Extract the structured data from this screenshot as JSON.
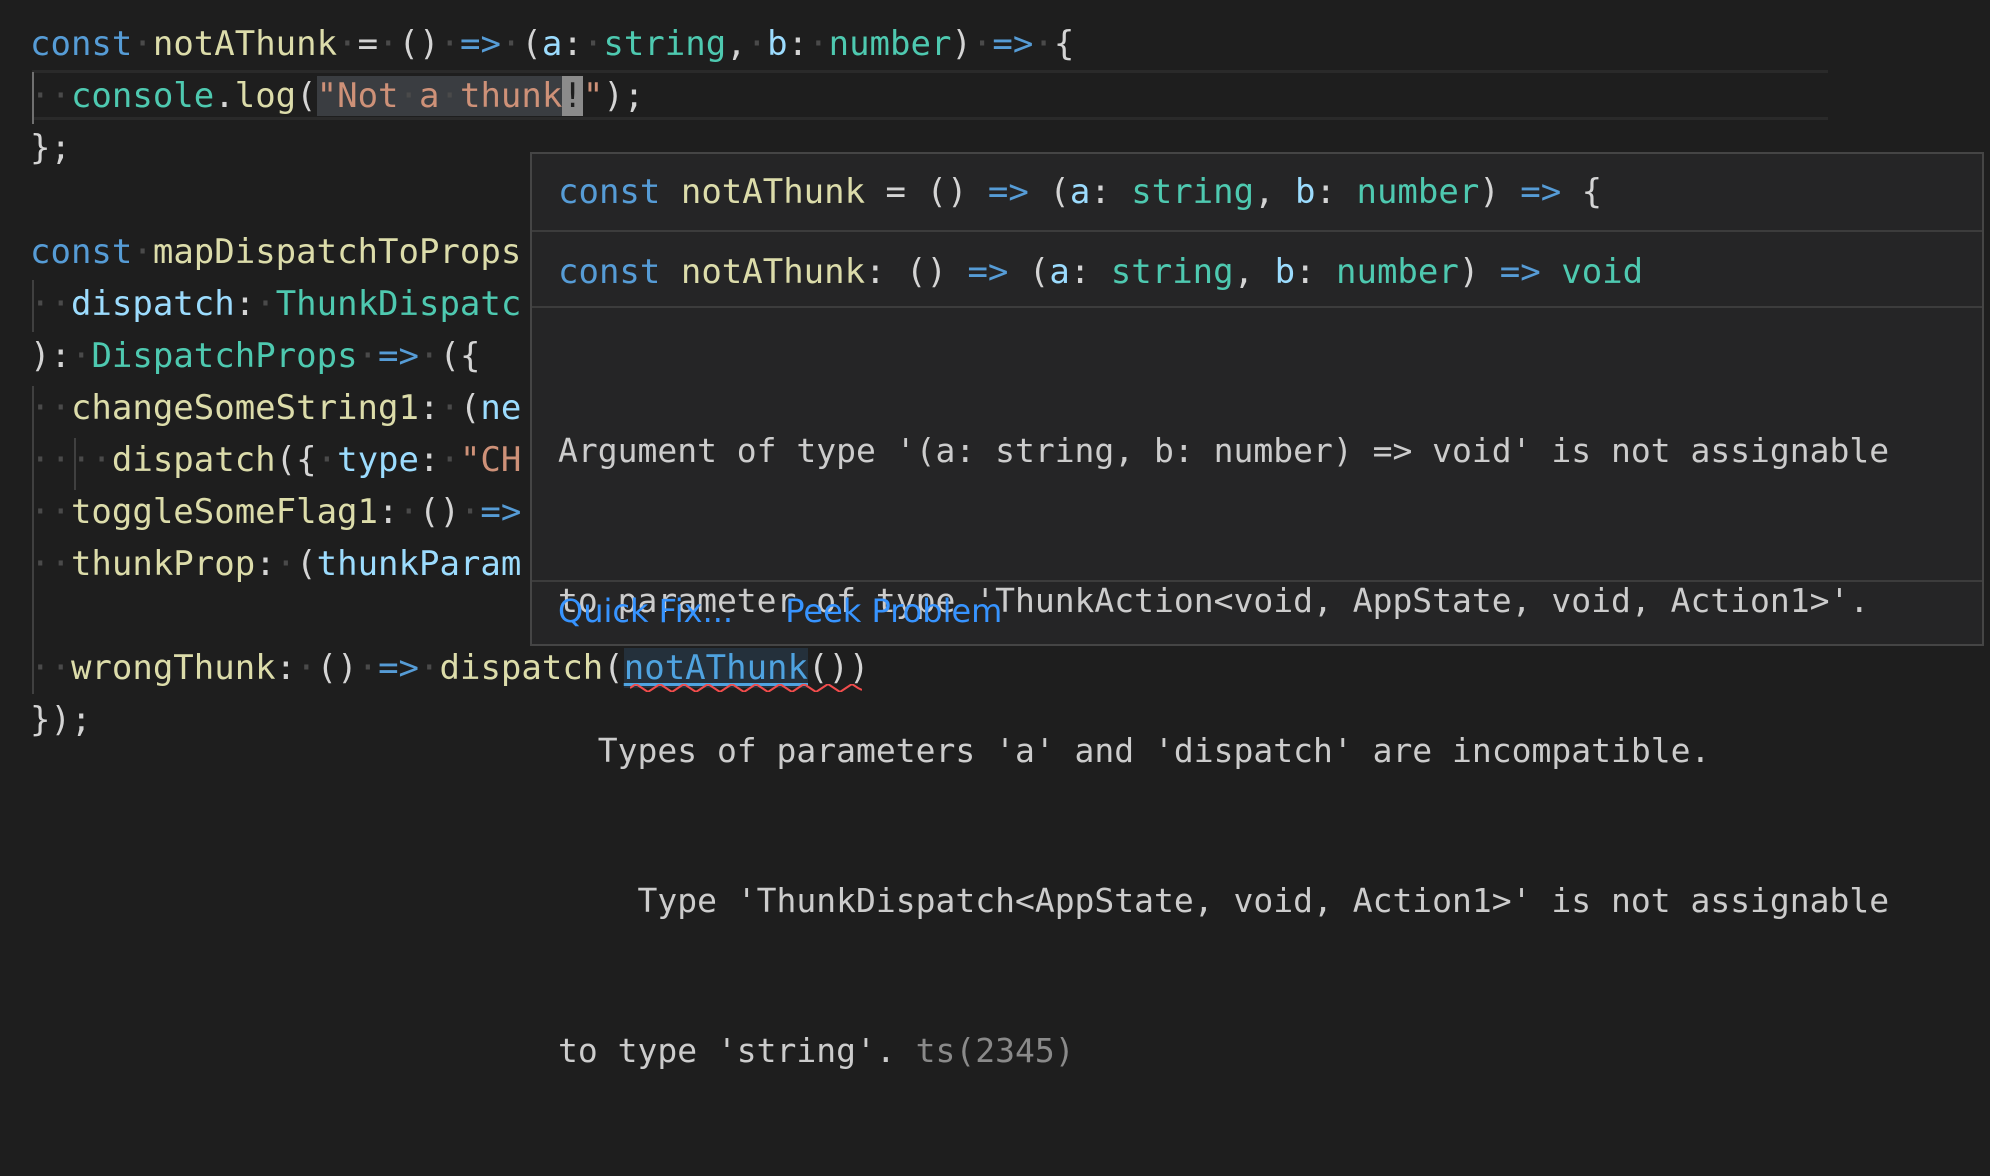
{
  "editor": {
    "lines": [
      {
        "tokens": [
          {
            "c": "kw",
            "t": "const"
          },
          {
            "c": "ws",
            "t": "·"
          },
          {
            "c": "fn",
            "t": "notAThunk"
          },
          {
            "c": "ws",
            "t": "·"
          },
          {
            "c": "pu",
            "t": "="
          },
          {
            "c": "ws",
            "t": "·"
          },
          {
            "c": "pu",
            "t": "()"
          },
          {
            "c": "ws",
            "t": "·"
          },
          {
            "c": "kw",
            "t": "=>"
          },
          {
            "c": "ws",
            "t": "·"
          },
          {
            "c": "pu",
            "t": "("
          },
          {
            "c": "pa",
            "t": "a"
          },
          {
            "c": "pu",
            "t": ":"
          },
          {
            "c": "ws",
            "t": "·"
          },
          {
            "c": "ty",
            "t": "string"
          },
          {
            "c": "pu",
            "t": ","
          },
          {
            "c": "ws",
            "t": "·"
          },
          {
            "c": "pa",
            "t": "b"
          },
          {
            "c": "pu",
            "t": ":"
          },
          {
            "c": "ws",
            "t": "·"
          },
          {
            "c": "ty",
            "t": "number"
          },
          {
            "c": "pu",
            "t": ")"
          },
          {
            "c": "ws",
            "t": "·"
          },
          {
            "c": "kw",
            "t": "=>"
          },
          {
            "c": "ws",
            "t": "·"
          },
          {
            "c": "pu",
            "t": "{"
          }
        ]
      },
      {
        "tokens": [
          {
            "c": "ws",
            "t": "··"
          },
          {
            "c": "ty",
            "t": "console"
          },
          {
            "c": "pu",
            "t": "."
          },
          {
            "c": "fn",
            "t": "log"
          },
          {
            "c": "pu",
            "t": "("
          },
          {
            "c": "st sel",
            "t": "\"Not"
          },
          {
            "c": "ws sel",
            "t": "·"
          },
          {
            "c": "st sel",
            "t": "a"
          },
          {
            "c": "ws sel",
            "t": "·"
          },
          {
            "c": "st sel",
            "t": "thunk"
          },
          {
            "c": "cursor",
            "t": "!"
          },
          {
            "c": "st",
            "t": "\""
          },
          {
            "c": "pu",
            "t": ");"
          }
        ]
      },
      {
        "tokens": [
          {
            "c": "pu",
            "t": "};"
          }
        ]
      },
      {
        "tokens": []
      },
      {
        "tokens": [
          {
            "c": "kw",
            "t": "const"
          },
          {
            "c": "ws",
            "t": "·"
          },
          {
            "c": "fn",
            "t": "mapDispatchToProps"
          }
        ]
      },
      {
        "tokens": [
          {
            "c": "ws",
            "t": "··"
          },
          {
            "c": "pa",
            "t": "dispatch"
          },
          {
            "c": "pu",
            "t": ":"
          },
          {
            "c": "ws",
            "t": "·"
          },
          {
            "c": "ty",
            "t": "ThunkDispatc"
          }
        ]
      },
      {
        "tokens": [
          {
            "c": "pu",
            "t": "):"
          },
          {
            "c": "ws",
            "t": "·"
          },
          {
            "c": "ty",
            "t": "DispatchProps"
          },
          {
            "c": "ws",
            "t": "·"
          },
          {
            "c": "kw",
            "t": "=>"
          },
          {
            "c": "ws",
            "t": "·"
          },
          {
            "c": "pu",
            "t": "({"
          }
        ]
      },
      {
        "tokens": [
          {
            "c": "ws",
            "t": "··"
          },
          {
            "c": "fn",
            "t": "changeSomeString1"
          },
          {
            "c": "pu",
            "t": ":"
          },
          {
            "c": "ws",
            "t": "·"
          },
          {
            "c": "pu",
            "t": "("
          },
          {
            "c": "pa",
            "t": "ne"
          }
        ]
      },
      {
        "tokens": [
          {
            "c": "ws",
            "t": "····"
          },
          {
            "c": "fn",
            "t": "dispatch"
          },
          {
            "c": "pu",
            "t": "({"
          },
          {
            "c": "ws",
            "t": "·"
          },
          {
            "c": "pa",
            "t": "type"
          },
          {
            "c": "pu",
            "t": ":"
          },
          {
            "c": "ws",
            "t": "·"
          },
          {
            "c": "st",
            "t": "\"CH"
          }
        ]
      },
      {
        "tokens": [
          {
            "c": "ws",
            "t": "··"
          },
          {
            "c": "fn",
            "t": "toggleSomeFlag1"
          },
          {
            "c": "pu",
            "t": ":"
          },
          {
            "c": "ws",
            "t": "·"
          },
          {
            "c": "pu",
            "t": "()"
          },
          {
            "c": "ws",
            "t": "·"
          },
          {
            "c": "kw",
            "t": "=>"
          }
        ]
      },
      {
        "tokens": [
          {
            "c": "ws",
            "t": "··"
          },
          {
            "c": "fn",
            "t": "thunkProp"
          },
          {
            "c": "pu",
            "t": ":"
          },
          {
            "c": "ws",
            "t": "·"
          },
          {
            "c": "pu",
            "t": "("
          },
          {
            "c": "pa",
            "t": "thunkParam"
          }
        ]
      },
      {
        "tokens": []
      },
      {
        "tokens": [
          {
            "c": "ws",
            "t": "··"
          },
          {
            "c": "fn",
            "t": "wrongThunk"
          },
          {
            "c": "pu",
            "t": ":"
          },
          {
            "c": "ws",
            "t": "·"
          },
          {
            "c": "pu",
            "t": "()"
          },
          {
            "c": "ws",
            "t": "·"
          },
          {
            "c": "kw",
            "t": "=>"
          },
          {
            "c": "ws",
            "t": "·"
          },
          {
            "c": "fn",
            "t": "dispatch"
          },
          {
            "c": "pu",
            "t": "("
          },
          {
            "c": "err",
            "t": "notAThunk"
          },
          {
            "c": "pu",
            "t": "())"
          }
        ]
      },
      {
        "tokens": [
          {
            "c": "pu",
            "t": "});"
          }
        ]
      }
    ]
  },
  "hover": {
    "source_line": [
      {
        "c": "kw",
        "t": "const"
      },
      {
        "c": "pu",
        "t": " "
      },
      {
        "c": "fn",
        "t": "notAThunk"
      },
      {
        "c": "pu",
        "t": " = () "
      },
      {
        "c": "kw",
        "t": "=>"
      },
      {
        "c": "pu",
        "t": " ("
      },
      {
        "c": "pa",
        "t": "a"
      },
      {
        "c": "pu",
        "t": ": "
      },
      {
        "c": "ty",
        "t": "string"
      },
      {
        "c": "pu",
        "t": ", "
      },
      {
        "c": "pa",
        "t": "b"
      },
      {
        "c": "pu",
        "t": ": "
      },
      {
        "c": "ty",
        "t": "number"
      },
      {
        "c": "pu",
        "t": ") "
      },
      {
        "c": "kw",
        "t": "=>"
      },
      {
        "c": "pu",
        "t": " {"
      }
    ],
    "signature": [
      {
        "c": "kw",
        "t": "const"
      },
      {
        "c": "pu",
        "t": " "
      },
      {
        "c": "fn",
        "t": "notAThunk"
      },
      {
        "c": "pu",
        "t": ": () "
      },
      {
        "c": "kw",
        "t": "=>"
      },
      {
        "c": "pu",
        "t": " ("
      },
      {
        "c": "pa",
        "t": "a"
      },
      {
        "c": "pu",
        "t": ": "
      },
      {
        "c": "ty",
        "t": "string"
      },
      {
        "c": "pu",
        "t": ", "
      },
      {
        "c": "pa",
        "t": "b"
      },
      {
        "c": "pu",
        "t": ": "
      },
      {
        "c": "ty",
        "t": "number"
      },
      {
        "c": "pu",
        "t": ") "
      },
      {
        "c": "kw",
        "t": "=>"
      },
      {
        "c": "pu",
        "t": " "
      },
      {
        "c": "ty",
        "t": "void"
      }
    ],
    "message_lines": [
      "Argument of type '(a: string, b: number) => void' is not assignable",
      "to parameter of type 'ThunkAction<void, AppState, void, Action1>'.",
      "  Types of parameters 'a' and 'dispatch' are incompatible.",
      "    Type 'ThunkDispatch<AppState, void, Action1>' is not assignable"
    ],
    "message_last": "to type 'string'.",
    "error_code": "ts(2345)",
    "actions": {
      "quick_fix": "Quick Fix...",
      "peek_problem": "Peek Problem"
    }
  }
}
